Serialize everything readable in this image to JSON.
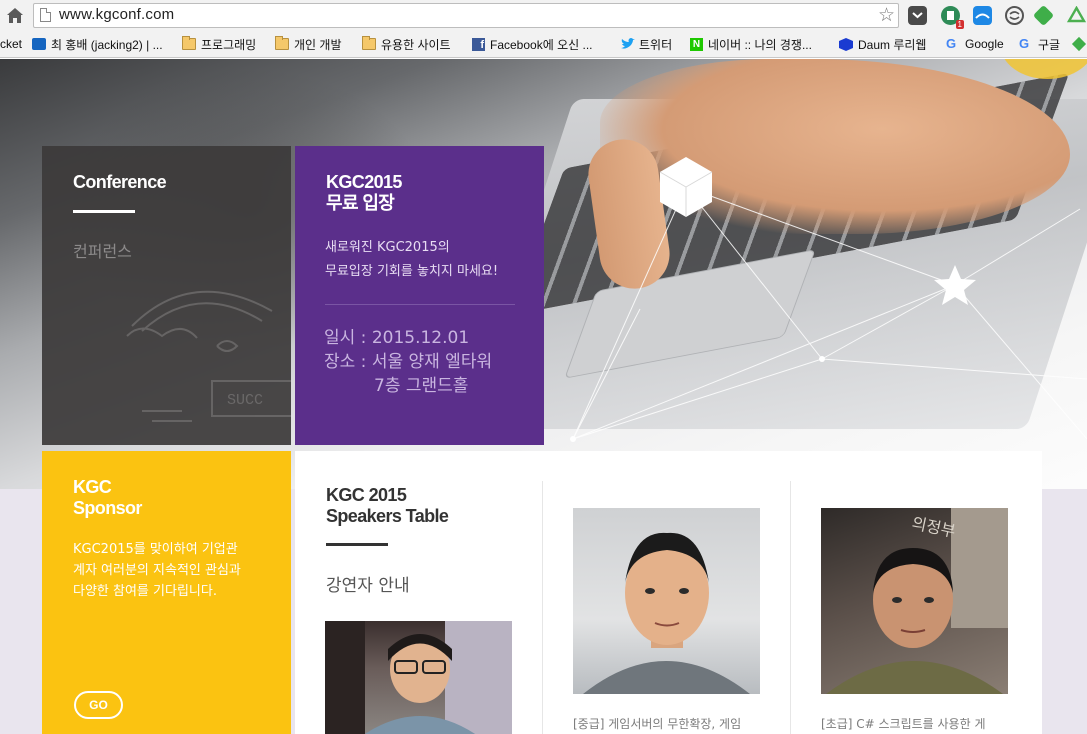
{
  "browser": {
    "url": "www.kgconf.com",
    "extensions": [
      {
        "name": "pocket-ext-icon",
        "color": "#444444"
      },
      {
        "name": "evernote-ext-icon",
        "color": "#2e8b57",
        "badge": "1"
      },
      {
        "name": "drive-ext-icon",
        "color": "#1e88e5"
      },
      {
        "name": "sync-ext-icon",
        "color": "#555555"
      },
      {
        "name": "tag-ext-icon",
        "color": "#3fae49"
      },
      {
        "name": "gdrive-ext-icon",
        "color": "#4caf50"
      }
    ]
  },
  "bookmarks": {
    "items": [
      {
        "label": "cket"
      },
      {
        "label": "최 홍배 (jacking2) | ..."
      },
      {
        "label": "프로그래밍"
      },
      {
        "label": "개인 개발"
      },
      {
        "label": "유용한 사이트"
      },
      {
        "label": "Facebook에 오신 ..."
      },
      {
        "label": "트위터"
      },
      {
        "label": "네이버 :: 나의 경쟁..."
      },
      {
        "label": "Daum 루리웹"
      },
      {
        "label": "Google"
      },
      {
        "label": "구글"
      }
    ]
  },
  "conference": {
    "title": "Conference",
    "subtitle": "컨퍼런스"
  },
  "free": {
    "title_line1": "KGC2015",
    "title_line2": "무료 입장",
    "desc_line1": "새로워진 KGC2015의",
    "desc_line2": "무료입장 기회를 놓치지 마세요!",
    "date": "일시 : 2015.12.01",
    "place_line1": "장소 : 서울 양재 엘타워",
    "place_line2": "7층 그랜드홀"
  },
  "sponsor": {
    "title_line1": "KGC",
    "title_line2": "Sponsor",
    "desc_line1": "KGC2015를 맞이하여 기업관",
    "desc_line2": "계자 여러분의 지속적인 관심과",
    "desc_line3": "다양한 참여를 기다립니다.",
    "go_label": "GO"
  },
  "speakers": {
    "title_line1": "KGC 2015",
    "title_line2": "Speakers Table",
    "subtitle": "강연자 안내",
    "items": [
      {
        "caption": "[중급] 게임서버의 무한확장, 게임"
      },
      {
        "caption": "[초급] C# 스크립트를 사용한 게"
      }
    ]
  },
  "colors": {
    "purple": "#5b2f8b",
    "yellow": "#fbc311",
    "dark": "#3c3a3a"
  }
}
